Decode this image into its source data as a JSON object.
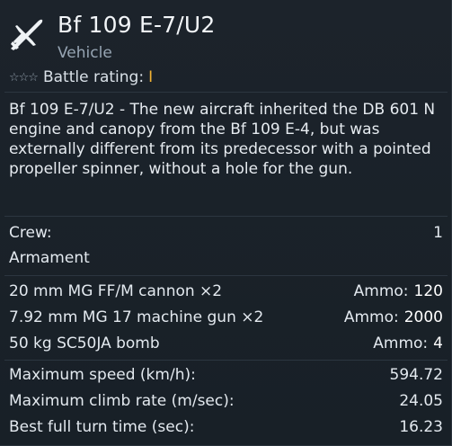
{
  "header": {
    "title": "Bf 109 E-7/U2",
    "subtitle": "Vehicle",
    "stars": "☆☆☆",
    "br_label": "Battle rating:",
    "br_value": "I",
    "icon": "fighter-plane-icon"
  },
  "description": "Bf 109 E-7/U2 - The new aircraft inherited the DB 601 N engine and canopy from the Bf 109 E-4, but was externally different from its predecessor with a pointed propeller spinner, without a hole for the gun.",
  "crew": {
    "label": "Crew:",
    "value": "1"
  },
  "armament": {
    "title": "Armament",
    "items": [
      {
        "name": "20 mm MG FF/M cannon ×2",
        "ammo_label": "Ammo:",
        "ammo": "120"
      },
      {
        "name": "7.92 mm MG 17 machine gun ×2",
        "ammo_label": "Ammo:",
        "ammo": "2000"
      },
      {
        "name": "50 kg SC50JA bomb",
        "ammo_label": "Ammo:",
        "ammo": "4"
      }
    ]
  },
  "stats": [
    {
      "label": "Maximum speed (km/h):",
      "value": "594.72"
    },
    {
      "label": "Maximum climb rate (m/sec):",
      "value": "24.05"
    },
    {
      "label": "Best full turn time (sec):",
      "value": "16.23"
    }
  ],
  "colors": {
    "background": "#171e25",
    "battle_rating": "#f2b233",
    "secondary_text": "#97a5b3"
  }
}
